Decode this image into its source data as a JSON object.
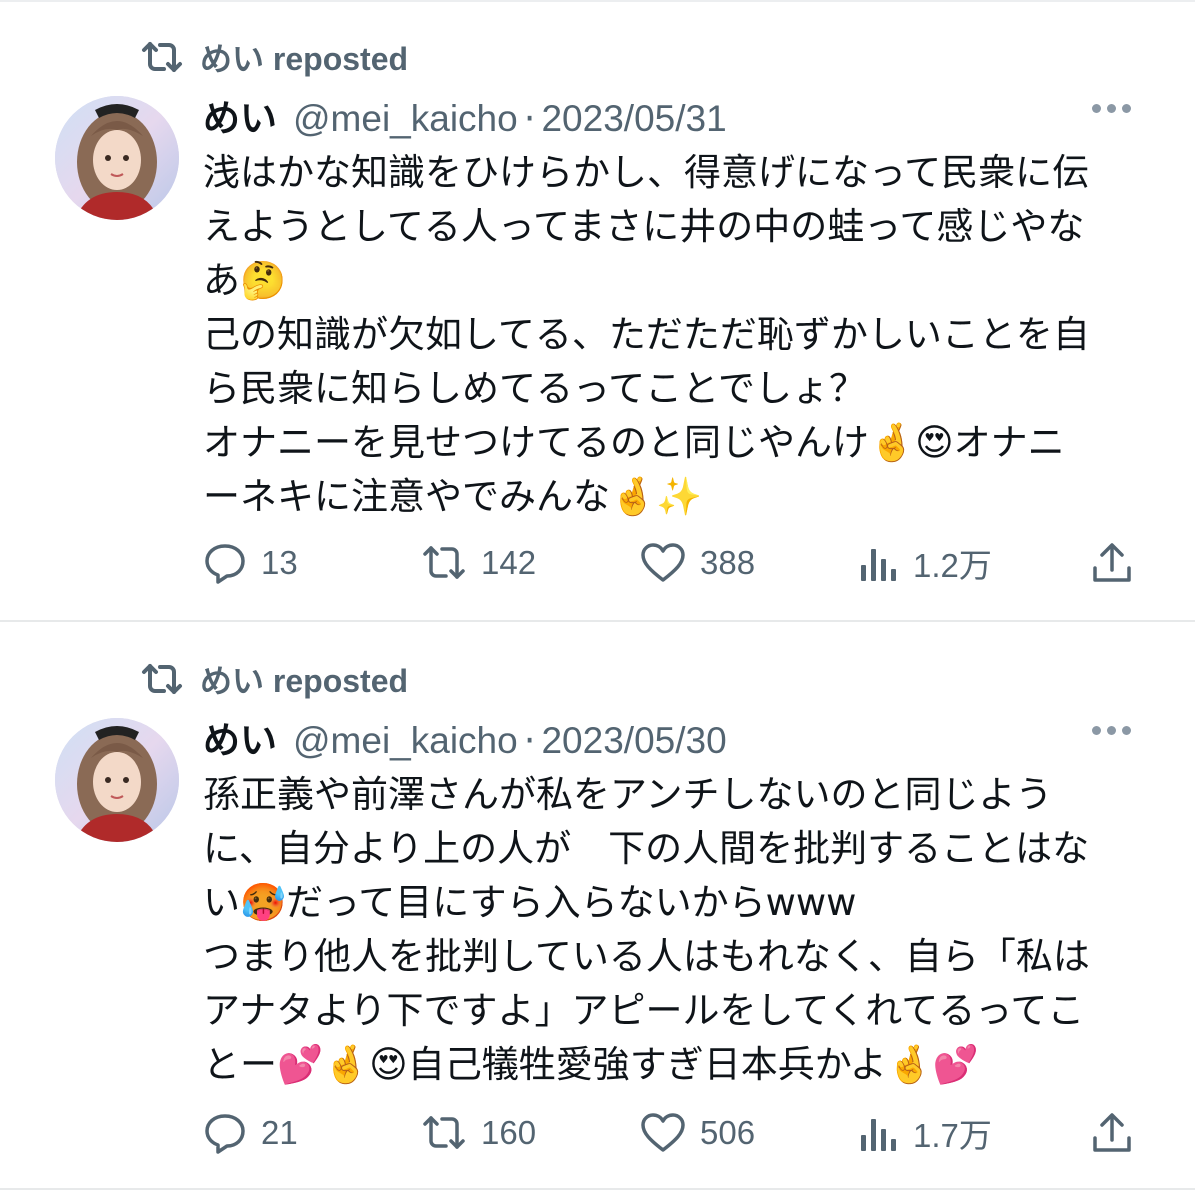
{
  "tweets": [
    {
      "repost_label": "めい reposted",
      "name": "めい",
      "handle": "@mei_kaicho",
      "separator": "·",
      "date": "2023/05/31",
      "lines": [
        "浅はかな知識をひけらかし、得意げになって民衆に伝",
        "えようとしてる人ってまさに井の中の蛙って感じやな",
        "あ🤔",
        "己の知識が欠如してる、ただただ恥ずかしいことを自",
        "ら民衆に知らしめてるってことでしょ？",
        "オナニーを見せつけてるのと同じやんけ🤞😍オナニ",
        "ーネキに注意やでみんな🤞✨"
      ],
      "stats": {
        "replies": "13",
        "reposts": "142",
        "likes": "388",
        "views": "1.2万"
      }
    },
    {
      "repost_label": "めい reposted",
      "name": "めい",
      "handle": "@mei_kaicho",
      "separator": "·",
      "date": "2023/05/30",
      "lines": [
        "孫正義や前澤さんが私をアンチしないのと同じよう",
        "に、自分より上の人が　下の人間を批判することはな",
        "い🥵だって目にすら入らないからwww",
        "つまり他人を批判している人はもれなく、自ら「私は",
        "アナタより下ですよ」アピールをしてくれてるってこ",
        "とー💕🤞😍自己犠牲愛強すぎ日本兵かよ🤞💕"
      ],
      "stats": {
        "replies": "21",
        "reposts": "160",
        "likes": "506",
        "views": "1.7万"
      }
    }
  ],
  "colors": {
    "text": "#0f1419",
    "secondary": "#536471",
    "divider": "#e7e9ea"
  },
  "icons": [
    "repost-icon",
    "reply-icon",
    "like-icon",
    "views-icon",
    "share-icon",
    "more-icon"
  ]
}
